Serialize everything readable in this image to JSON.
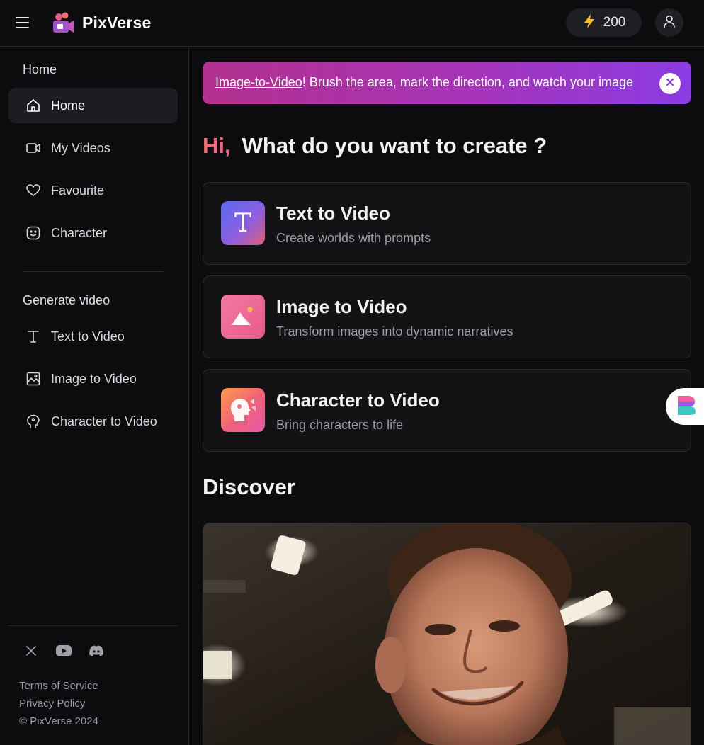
{
  "header": {
    "logo_text": "PixVerse",
    "credits": "200",
    "credits_icon": "lightning-icon",
    "menu_icon": "hamburger-icon",
    "user_icon": "user-icon"
  },
  "sidebar": {
    "section_home": "Home",
    "home_items": [
      {
        "label": "Home",
        "icon": "home-icon",
        "active": true
      },
      {
        "label": "My Videos",
        "icon": "video-camera-icon"
      },
      {
        "label": "Favourite",
        "icon": "heart-icon"
      },
      {
        "label": "Character",
        "icon": "smiley-icon"
      }
    ],
    "section_generate": "Generate video",
    "generate_items": [
      {
        "label": "Text to Video",
        "icon": "text-t-icon"
      },
      {
        "label": "Image to Video",
        "icon": "image-icon"
      },
      {
        "label": "Character to Video",
        "icon": "head-icon"
      }
    ],
    "socials": [
      "x-icon",
      "youtube-icon",
      "discord-icon"
    ],
    "footer": {
      "terms": "Terms of Service",
      "privacy": "Privacy Policy",
      "copyright": "© PixVerse 2024"
    }
  },
  "banner": {
    "link_text": "Image-to-Video",
    "text": "! Brush the area, mark the direction, and watch your image"
  },
  "greeting": {
    "hi": "Hi,",
    "question": "What do you want to create ?"
  },
  "cards": [
    {
      "title": "Text to Video",
      "description": "Create worlds with prompts",
      "icon_letter": "T"
    },
    {
      "title": "Image to Video",
      "description": "Transform images into dynamic narratives"
    },
    {
      "title": "Character to Video",
      "description": "Bring characters to life"
    }
  ],
  "discover": {
    "title": "Discover"
  },
  "colors": {
    "background": "#0c0c0e",
    "banner_start": "#b3318f",
    "banner_end": "#8a3be3",
    "accent_yellow": "#f5c518"
  }
}
